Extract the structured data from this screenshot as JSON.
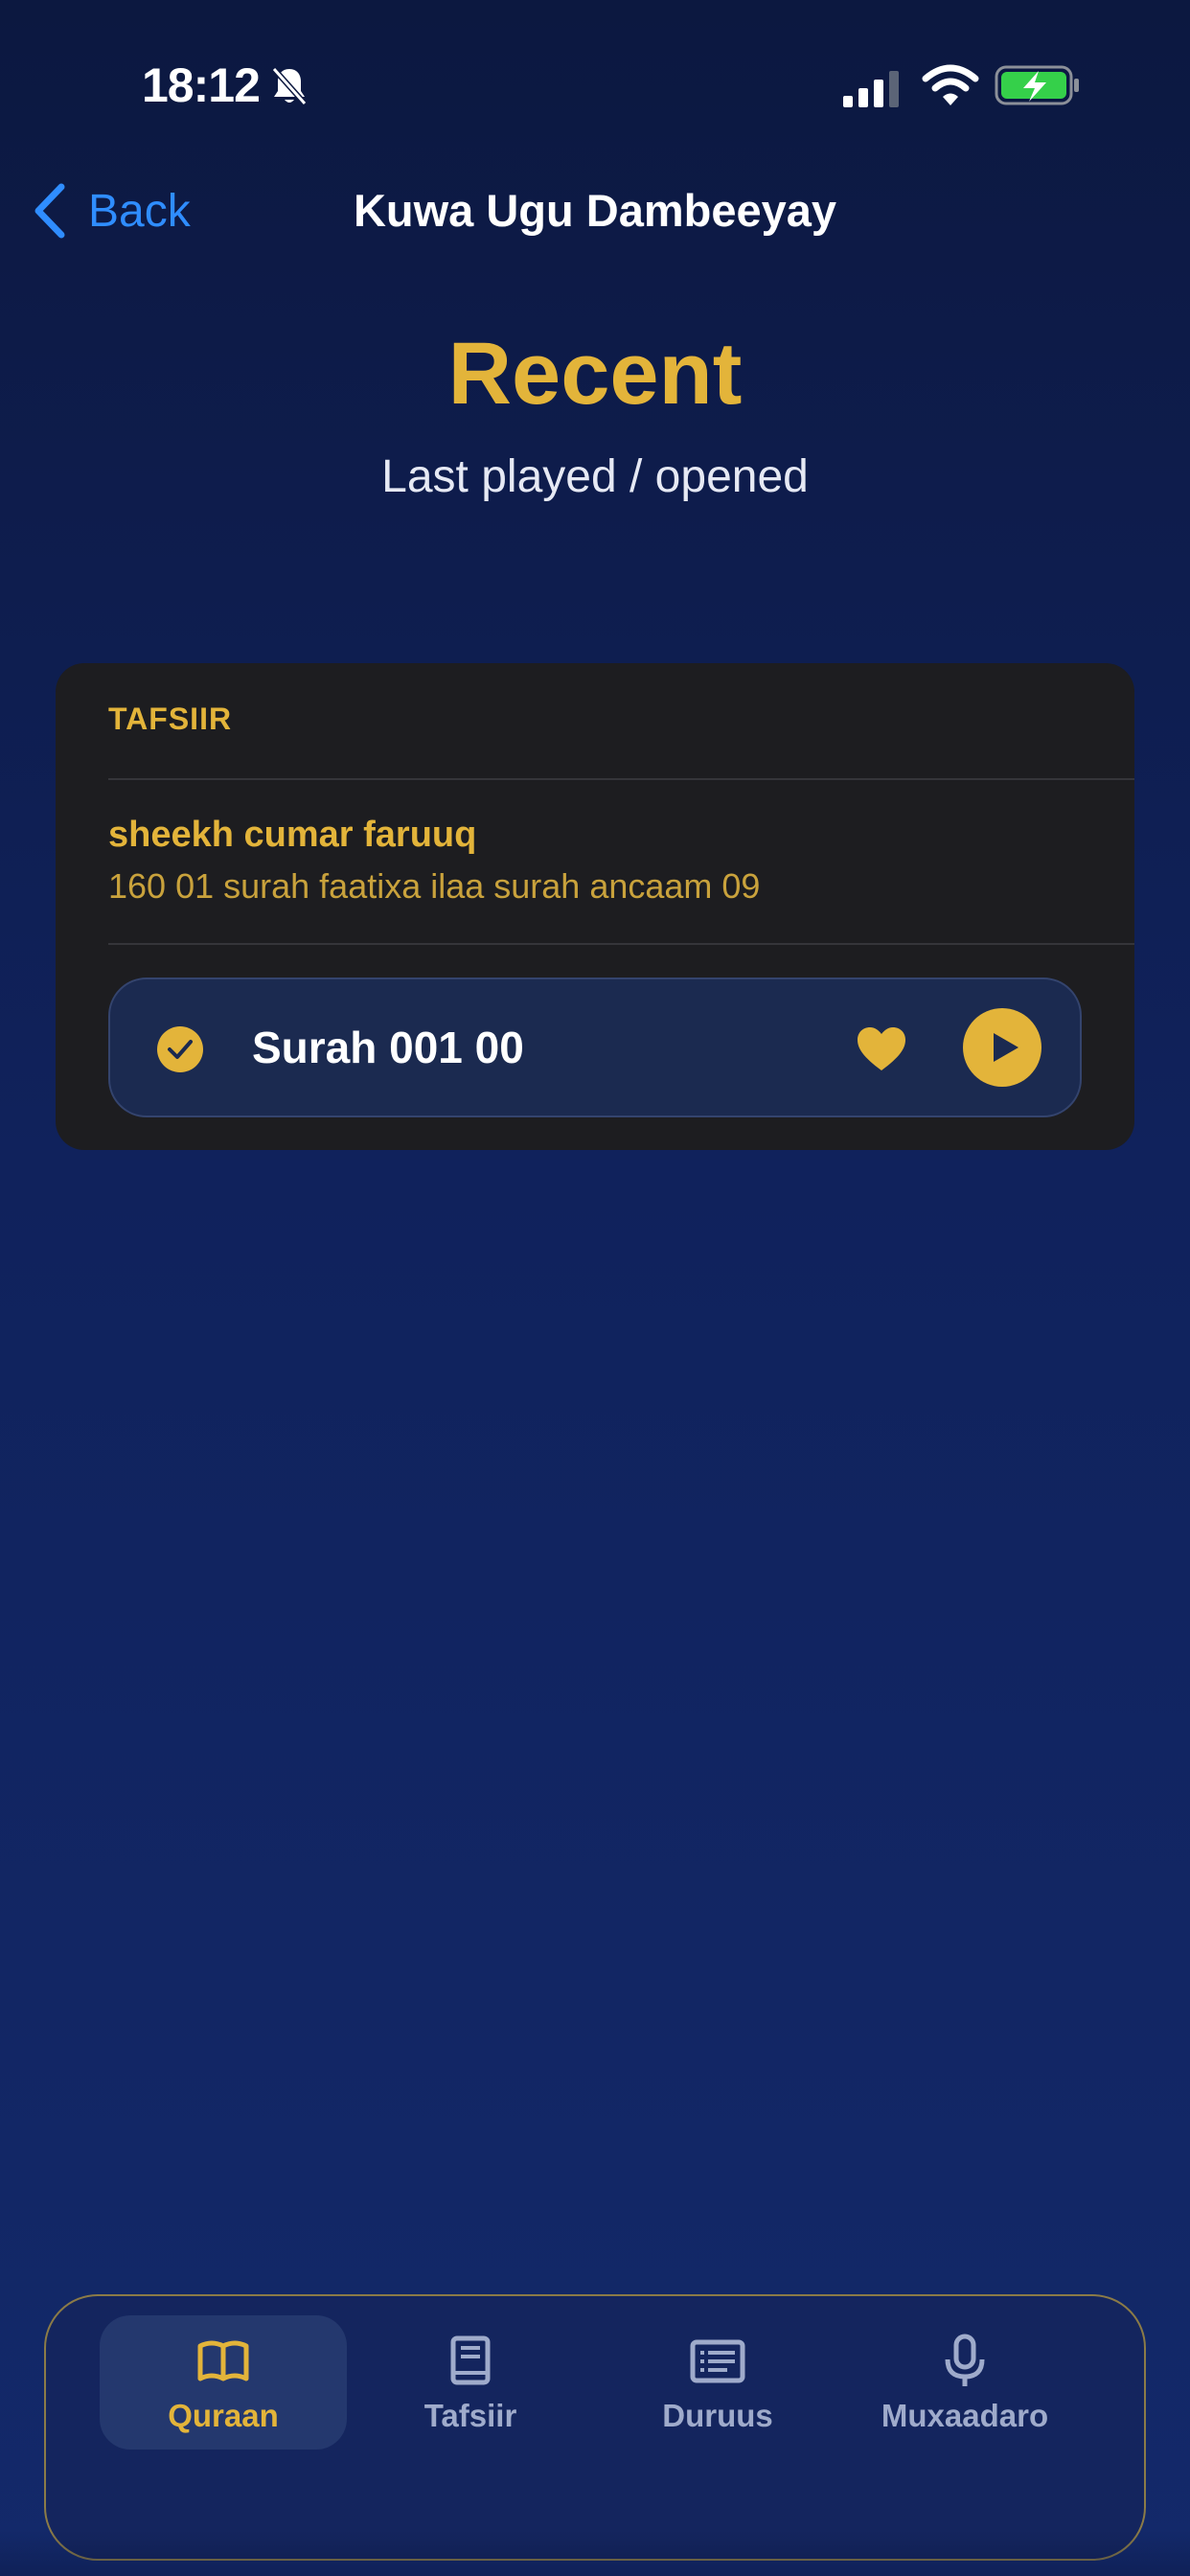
{
  "status_bar": {
    "time": "18:12",
    "icons": [
      "bell-slash-icon",
      "cellular-signal-icon",
      "wifi-icon",
      "battery-charging-icon"
    ],
    "battery_color": "#35d04a"
  },
  "nav": {
    "back_label": "Back",
    "title": "Kuwa Ugu Dambeeyay"
  },
  "hero": {
    "title": "Recent",
    "subtitle": "Last played / opened"
  },
  "recent_card": {
    "section_label": "TAFSIIR",
    "item": {
      "title": "sheekh cumar faruuq",
      "subtitle": "160 01 surah faatixa ilaa surah ancaam 09"
    },
    "track": {
      "title": "Surah 001 00",
      "status_icon": "check-circle-icon",
      "favorite_icon": "heart-icon",
      "play_icon": "play-icon"
    }
  },
  "tab_bar": {
    "tabs": [
      {
        "label": "Quraan",
        "icon": "book-open-icon",
        "active": true
      },
      {
        "label": "Tafsiir",
        "icon": "book-icon",
        "active": false
      },
      {
        "label": "Duruus",
        "icon": "list-doc-icon",
        "active": false
      },
      {
        "label": "Muxaadaro",
        "icon": "microphone-icon",
        "active": false
      }
    ]
  },
  "colors": {
    "accent": "#e3b43a",
    "link": "#2f8dff",
    "background_top": "#0c1840",
    "background_bottom": "#13296a",
    "card": "#1d1d20"
  }
}
